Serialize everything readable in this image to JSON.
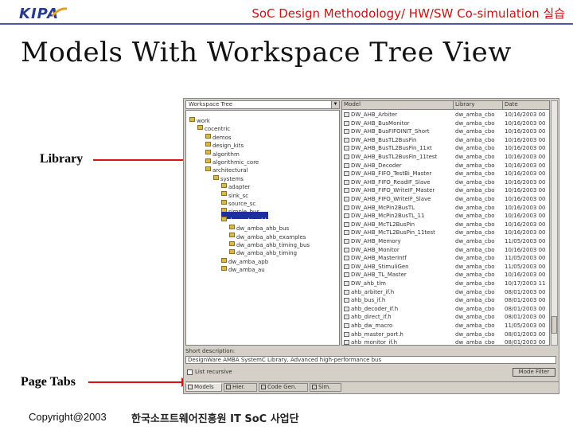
{
  "header": {
    "logo_text": "KIPA",
    "title": "SoC Design Methodology/ HW/SW Co-simulation 실습",
    "accent_color": "#cc1111",
    "rule_color": "#4d56a8"
  },
  "slide_title": "Models With Workspace Tree View",
  "annotations": {
    "library": "Library",
    "page_tabs": "Page Tabs",
    "arrow_color": "#dd1111"
  },
  "app": {
    "tree_header": "Workspace Tree",
    "tree": [
      "work",
      "cocentric",
      "demos",
      "design_kits",
      "algorithm",
      "algorithmic_core",
      "architectural",
      "systems",
      "adapter",
      "sink_sc",
      "source_sc",
      "simple_bus",
      "dw_amba_ahb",
      "dw_amba_ahb_bus",
      "dw_amba_ahb_examples",
      "dw_amba_ahb_timing_bus",
      "dw_amba_ahb_timing",
      "dw_amba_apb",
      "dw_amba_au"
    ],
    "list_columns": [
      "Model",
      "Library",
      "Date"
    ],
    "list_rows": [
      [
        "DW_AHB_Arbiter",
        "dw_amba_cbo",
        "10/16/2003 00"
      ],
      [
        "DW_AHB_BusMonitor",
        "dw_amba_cbo",
        "10/16/2003 00"
      ],
      [
        "DW_AHB_BusFIFOINIT_Short",
        "dw_amba_cbo",
        "10/16/2003 00"
      ],
      [
        "DW_AHB_BusTL2BusFin",
        "dw_amba_cbo",
        "10/16/2003 00"
      ],
      [
        "DW_AHB_BusTL2BusFin_11xt",
        "dw_amba_cbo",
        "10/16/2003 00"
      ],
      [
        "DW_AHB_BusTL2BusFin_11test",
        "dw_amba_cbo",
        "10/16/2003 00"
      ],
      [
        "DW_AHB_Decoder",
        "dw_amba_cbo",
        "10/16/2003 00"
      ],
      [
        "DW_AHB_FIFO_TestBi_Master",
        "dw_amba_cbo",
        "10/16/2003 00"
      ],
      [
        "DW_AHB_FIFO_ReadIF_Slave",
        "dw_amba_cbo",
        "10/16/2003 00"
      ],
      [
        "DW_AHB_FIFO_WriteIF_Master",
        "dw_amba_cbo",
        "10/16/2003 00"
      ],
      [
        "DW_AHB_FIFO_WriteIF_Slave",
        "dw_amba_cbo",
        "10/16/2003 00"
      ],
      [
        "DW_AHB_McPin2BusTL",
        "dw_amba_cbo",
        "10/16/2003 00"
      ],
      [
        "DW_AHB_McPin2BusTL_11",
        "dw_amba_cbo",
        "10/16/2003 00"
      ],
      [
        "DW_AHB_McTL2BusPin",
        "dw_amba_cbo",
        "10/16/2003 00"
      ],
      [
        "DW_AHB_McTL2BusPin_11test",
        "dw_amba_cbo",
        "10/16/2003 00"
      ],
      [
        "DW_AHB_Memory",
        "dw_amba_cbo",
        "11/05/2003 00"
      ],
      [
        "DW_AHB_Monitor",
        "dw_amba_cbo",
        "10/16/2003 00"
      ],
      [
        "DW_AHB_MasterIntf",
        "dw_amba_cbo",
        "11/05/2003 00"
      ],
      [
        "DW_AHB_StimuliGen",
        "dw_amba_cbo",
        "11/05/2003 00"
      ],
      [
        "DW_AHB_TL_Master",
        "dw_amba_cbo",
        "10/16/2003 00"
      ],
      [
        "DW_ahb_tlm",
        "dw_amba_cbo",
        "10/17/2003 11"
      ],
      [
        "ahb_arbiter_if.h",
        "dw_amba_cbo",
        "08/01/2003 00"
      ],
      [
        "ahb_bus_if.h",
        "dw_amba_cbo",
        "08/01/2003 00"
      ],
      [
        "ahb_decoder_if.h",
        "dw_amba_cbo",
        "08/01/2003 00"
      ],
      [
        "ahb_direct_if.h",
        "dw_amba_cbo",
        "08/01/2003 00"
      ],
      [
        "ahb_dw_macro",
        "dw_amba_cbo",
        "11/05/2003 00"
      ],
      [
        "ahb_master_port.h",
        "dw_amba_cbo",
        "08/01/2003 00"
      ],
      [
        "ahb_monitor_if.h",
        "dw_amba_cbo",
        "08/01/2003 00"
      ]
    ],
    "short_description_label": "Short description:",
    "short_description": "DesignWare AMBA SystemC Library, Advanced high-performance bus",
    "recursive_label": "List recursive",
    "mode_filter_label": "Mode Filter",
    "tabs": [
      "Models",
      "Hier.",
      "Code Gen.",
      "Sim."
    ]
  },
  "footer": {
    "copyright": "Copyright@2003",
    "org": "한국소프트웨어진흥원 IT SoC 사업단"
  }
}
